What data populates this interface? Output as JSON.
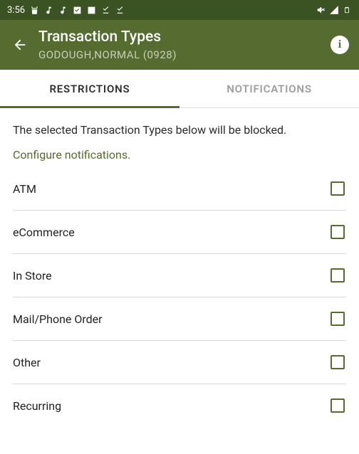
{
  "statusbar": {
    "time": "3:56"
  },
  "appbar": {
    "title": "Transaction Types",
    "subtitle": "GODOUGH,NORMAL (0928)"
  },
  "tabs": {
    "restrictions": "RESTRICTIONS",
    "notifications": "NOTIFICATIONS"
  },
  "content": {
    "description": "The selected Transaction Types below will be blocked.",
    "configure_link": "Configure notifications."
  },
  "items": [
    {
      "label": "ATM",
      "checked": false
    },
    {
      "label": "eCommerce",
      "checked": false
    },
    {
      "label": "In Store",
      "checked": false
    },
    {
      "label": "Mail/Phone Order",
      "checked": false
    },
    {
      "label": "Other",
      "checked": false
    },
    {
      "label": "Recurring",
      "checked": false
    }
  ]
}
